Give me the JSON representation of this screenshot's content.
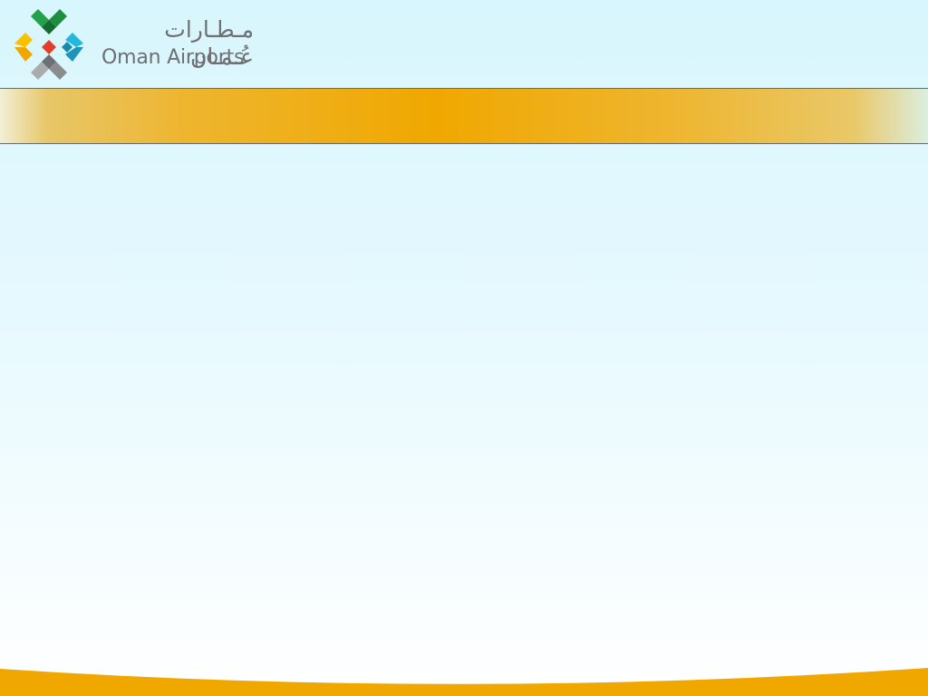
{
  "brand": {
    "name_ar": "مـطـارات عُـمـان",
    "name_en": "Oman Airports"
  },
  "colors": {
    "band_accent": "#f0a800",
    "footer_accent": "#f0a800",
    "background_top": "#d8f6fd",
    "background_bottom": "#ffffff",
    "logo_text": "#6e6f73",
    "logo_green": "#2a9a3c",
    "logo_red": "#e0402a",
    "logo_yellow": "#f5b400",
    "logo_blue": "#22b2d6",
    "logo_gray": "#8a8c8e"
  },
  "title_band": {
    "title": ""
  },
  "content": {
    "body": ""
  }
}
